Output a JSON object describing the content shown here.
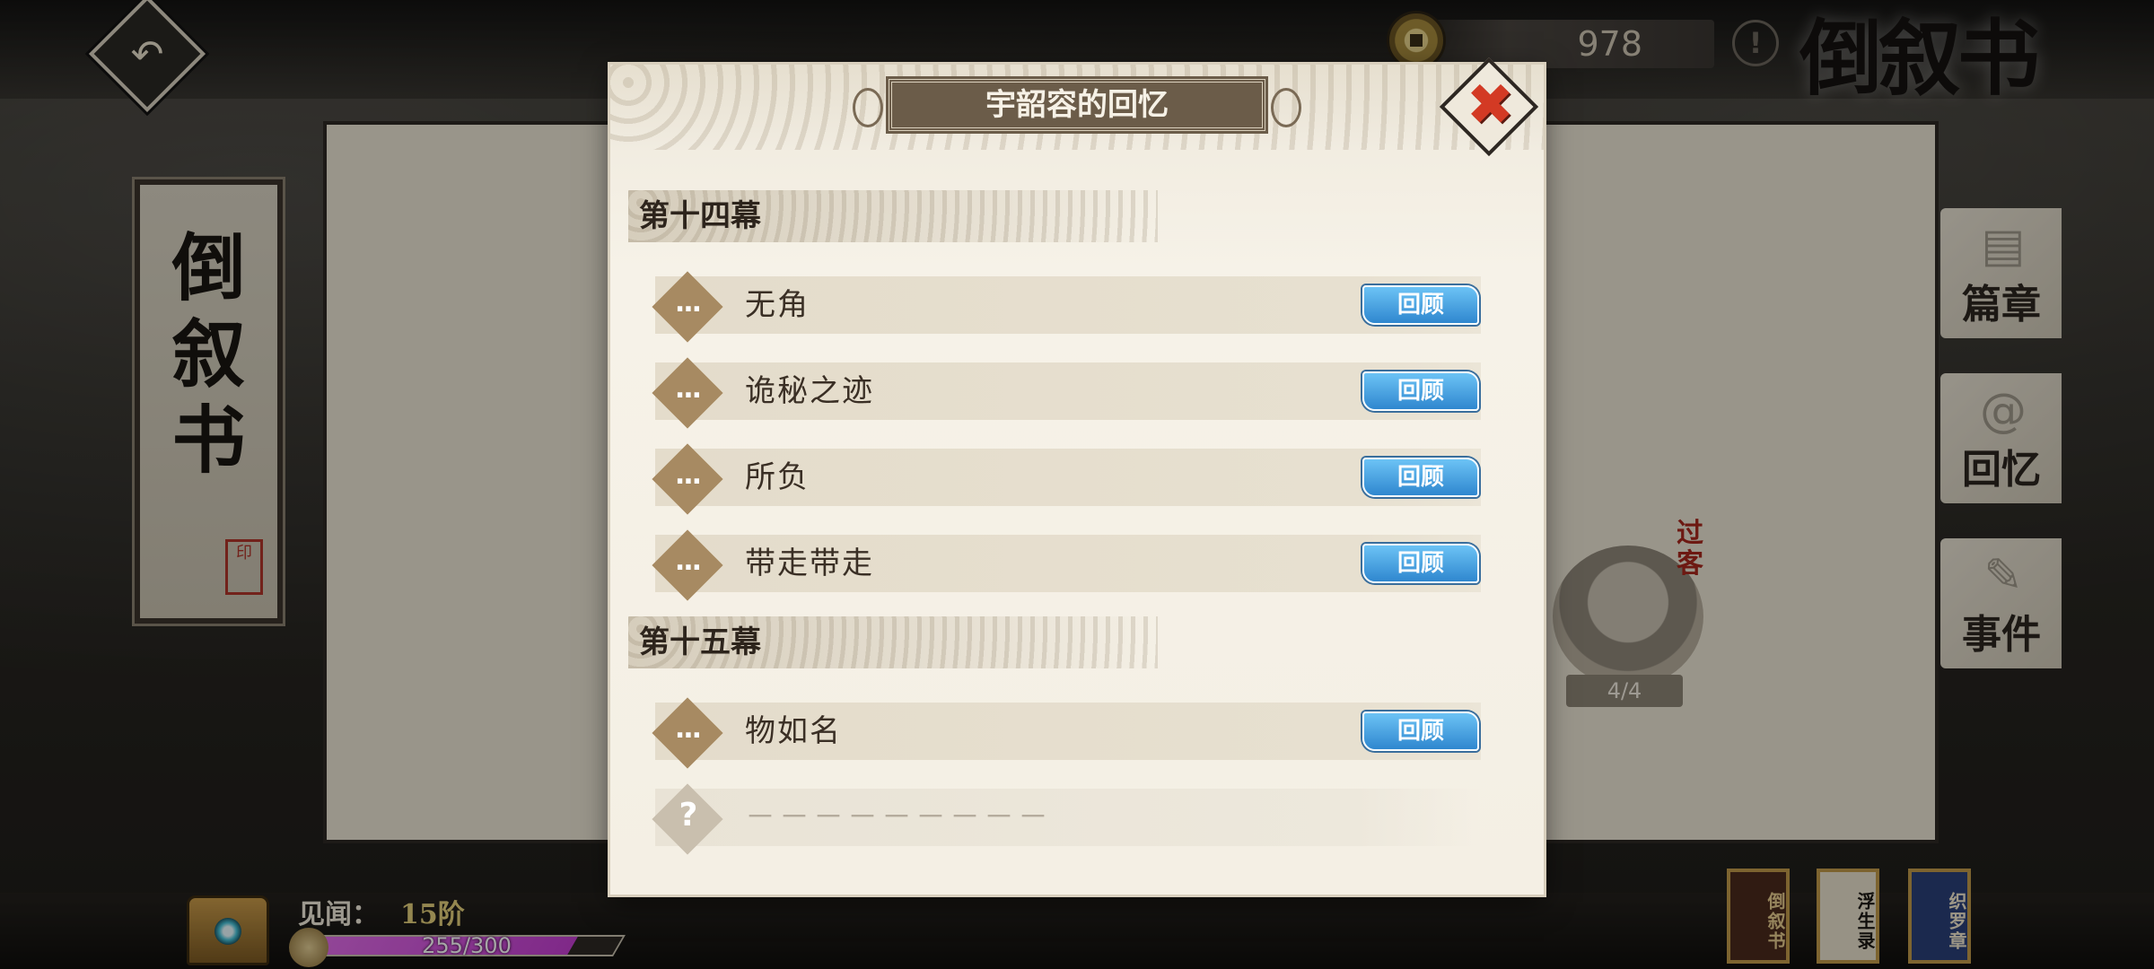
{
  "top": {
    "coin_value": "978",
    "info_glyph": "!",
    "title": "倒叙书"
  },
  "left_scroll": {
    "title_chars": [
      "倒",
      "叙",
      "书"
    ],
    "seal": "印"
  },
  "side_tabs": [
    {
      "label": "篇章",
      "icon": "pages-icon"
    },
    {
      "label": "回忆",
      "icon": "swirl-icon"
    },
    {
      "label": "事件",
      "icon": "scroll-icon"
    }
  ],
  "character": {
    "count": "4/4",
    "tag": "过客"
  },
  "bottom": {
    "rank_label": "见闻：",
    "rank_value": "15阶",
    "exp_text": "255/300",
    "exp_fraction": 0.85,
    "book_tabs": [
      "倒叙书",
      "浮生录",
      "织罗章"
    ]
  },
  "modal": {
    "title": "宇韶容的回忆",
    "acts": [
      {
        "title": "第十四幕",
        "entries": [
          {
            "name": "无角",
            "button": "回顾",
            "icon": "..."
          },
          {
            "name": "诡秘之迹",
            "button": "回顾",
            "icon": "..."
          },
          {
            "name": "所负",
            "button": "回顾",
            "icon": "..."
          },
          {
            "name": "带走带走",
            "button": "回顾",
            "icon": "..."
          }
        ]
      },
      {
        "title": "第十五幕",
        "entries": [
          {
            "name": "物如名",
            "button": "回顾",
            "icon": "..."
          },
          {
            "name": "－－－－－－－－－",
            "locked": true,
            "icon": "?"
          }
        ]
      }
    ]
  },
  "colors": {
    "accent_blue": "#2f87cf",
    "exp_magenta": "#c43fd2",
    "close_red": "#d33a24"
  }
}
